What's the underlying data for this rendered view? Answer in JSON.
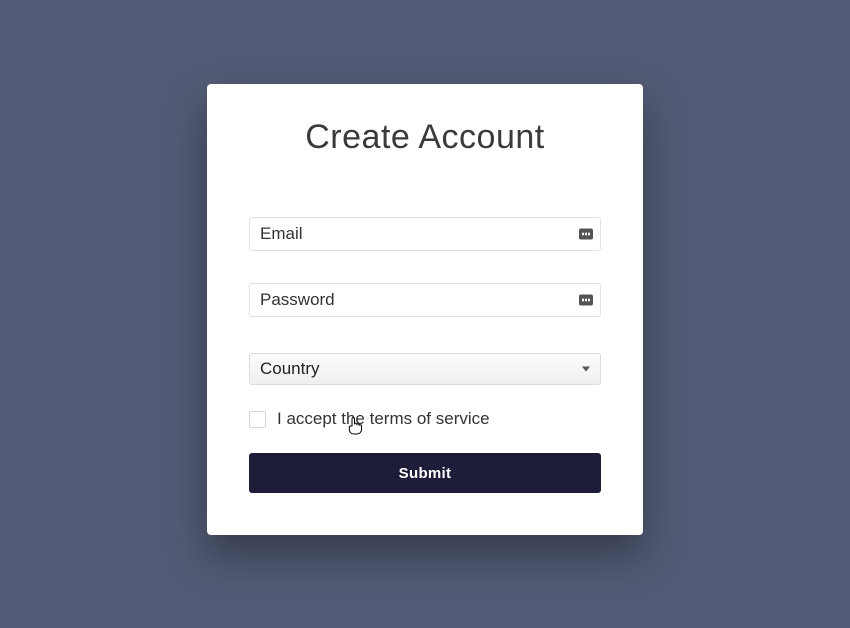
{
  "form": {
    "title": "Create Account",
    "email": {
      "placeholder": "Email",
      "value": ""
    },
    "password": {
      "placeholder": "Password",
      "value": ""
    },
    "country": {
      "selected": "Country"
    },
    "tos": {
      "label": "I accept the terms of service",
      "checked": false
    },
    "submit_label": "Submit"
  }
}
